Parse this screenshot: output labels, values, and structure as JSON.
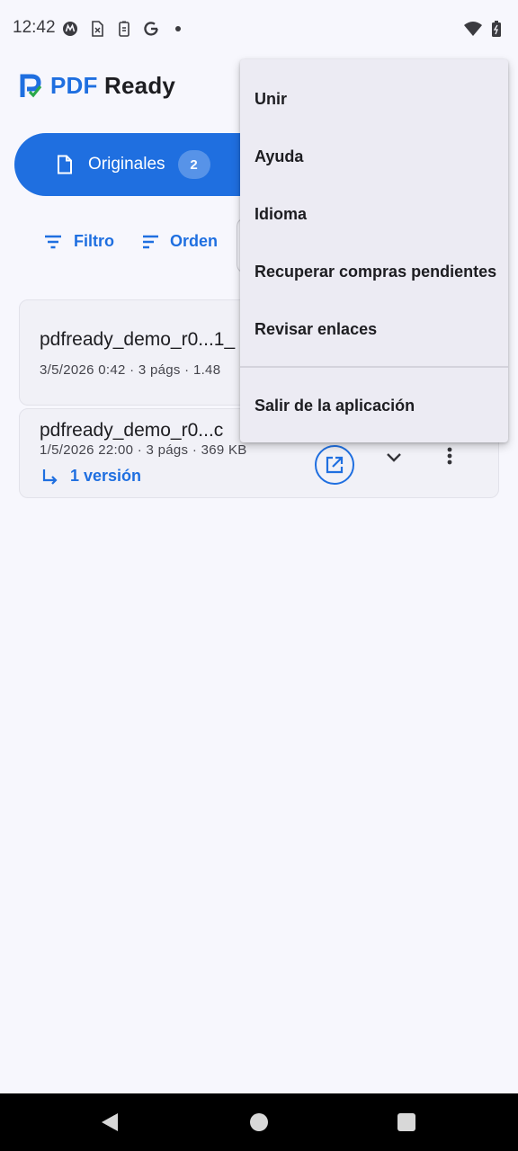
{
  "status_bar": {
    "time": "12:42",
    "icons_left": [
      "motorola-icon",
      "sim-card-icon",
      "battery-saver-icon",
      "google-icon",
      "dot-icon"
    ],
    "icons_right": [
      "wifi-icon",
      "battery-icon"
    ]
  },
  "app": {
    "title_part1": "PDF",
    "title_part2": "Ready",
    "brand_color": "#1f6fe0"
  },
  "tabs": {
    "originales_label": "Originales",
    "originales_count": "2"
  },
  "actions": {
    "filter_label": "Filtro",
    "sort_label": "Orden"
  },
  "files": [
    {
      "name": "pdfready_demo_r0...1_",
      "meta": "3/5/2026 0:42 · 3 págs · 1.48"
    },
    {
      "name": "pdfready_demo_r0...c",
      "meta": "1/5/2026 22:00 · 3 págs · 369 KB",
      "version_label": "1 versión"
    }
  ],
  "menu": {
    "items": [
      "Unir",
      "Ayuda",
      "Idioma",
      "Recuperar compras pendientes",
      "Revisar enlaces"
    ],
    "exit_label": "Salir de la aplicación"
  }
}
